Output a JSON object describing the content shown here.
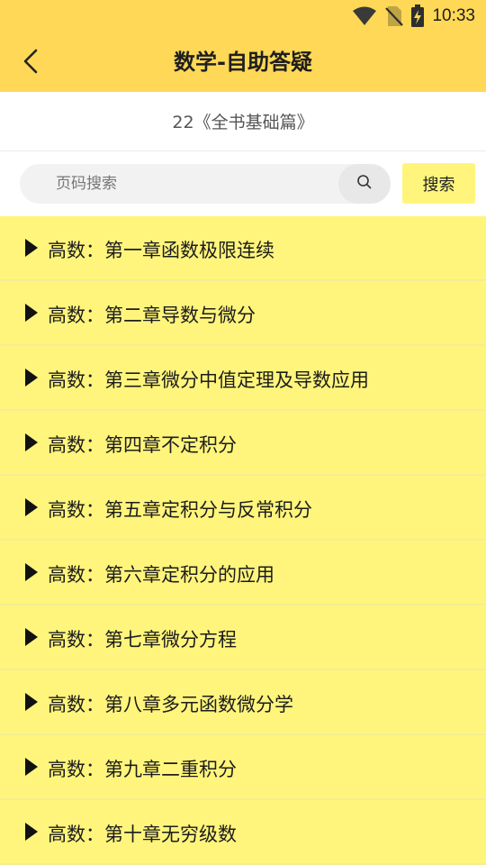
{
  "status_bar": {
    "time": "10:33",
    "icons": [
      "wifi-icon",
      "no-sim-icon",
      "battery-charging-icon"
    ]
  },
  "header": {
    "title": "数学-自助答疑",
    "back_icon": "chevron-left-icon"
  },
  "book": {
    "title": "22《全书基础篇》"
  },
  "search": {
    "placeholder": "页码搜索",
    "value": "",
    "icon": "search-icon",
    "button_label": "搜索"
  },
  "chapters": [
    {
      "label": "高数：第一章函数极限连续"
    },
    {
      "label": "高数：第二章导数与微分"
    },
    {
      "label": "高数：第三章微分中值定理及导数应用"
    },
    {
      "label": "高数：第四章不定积分"
    },
    {
      "label": "高数：第五章定积分与反常积分"
    },
    {
      "label": "高数：第六章定积分的应用"
    },
    {
      "label": "高数：第七章微分方程"
    },
    {
      "label": "高数：第八章多元函数微分学"
    },
    {
      "label": "高数：第九章二重积分"
    },
    {
      "label": "高数：第十章无穷级数"
    }
  ],
  "colors": {
    "header_bg": "#fed856",
    "list_bg": "#fff57c",
    "search_button_bg": "#fff57c"
  }
}
